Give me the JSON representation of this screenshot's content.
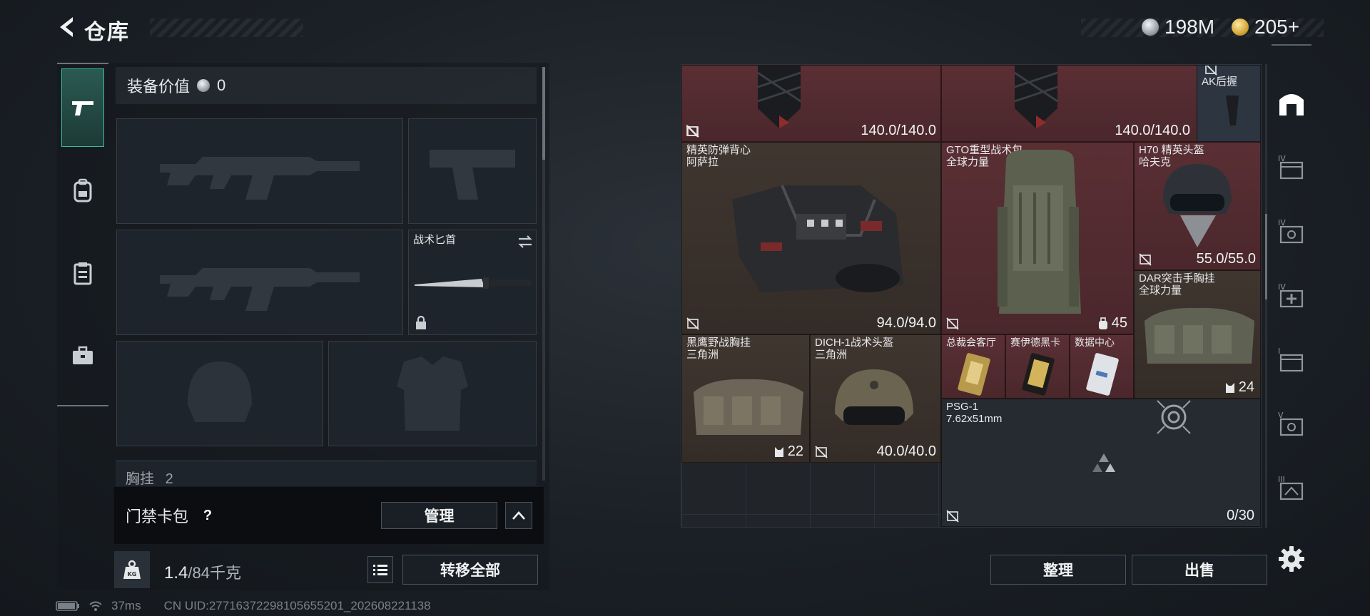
{
  "header": {
    "title": "仓库"
  },
  "currency": {
    "silver": {
      "value": "198M",
      "icon": "silver-coin-icon",
      "color": "#c8ccd0"
    },
    "gold": {
      "value": "205+",
      "icon": "gold-coin-icon",
      "color": "#d4a63a"
    }
  },
  "left": {
    "tabs": [
      "gun-icon",
      "backpack-icon",
      "clipboard-icon",
      "briefcase-icon"
    ],
    "equip_value_label": "装备价值",
    "equip_value": "0",
    "knife_slot": {
      "name": "战术匕首"
    },
    "chest_rig_label": "胸挂",
    "chest_rig_count": "2",
    "keycard": {
      "label": "门禁卡包",
      "help": "?",
      "manage": "管理"
    },
    "weight": {
      "current": "1.4",
      "max": "/84千克",
      "unit_icon": "KG"
    },
    "transfer_all": "转移全部"
  },
  "status": {
    "ping": "37ms",
    "uid": "CN UID:27716372298105655201_202608221138"
  },
  "grid": {
    "items": [
      {
        "id": "top-left",
        "durability": "140.0/140.0"
      },
      {
        "id": "top-mid",
        "durability": "140.0/140.0"
      },
      {
        "id": "ak-grip",
        "name": "AK后握"
      },
      {
        "id": "vest",
        "name1": "精英防弹背心",
        "name2": "阿萨拉",
        "durability": "94.0/94.0"
      },
      {
        "id": "backpack",
        "name1": "GTO重型战术包",
        "name2": "全球力量",
        "count": "45"
      },
      {
        "id": "h70",
        "name1": "H70 精英头盔",
        "name2": "哈夫克",
        "durability": "55.0/55.0"
      },
      {
        "id": "dar-rig",
        "name1": "DAR突击手胸挂",
        "name2": "全球力量",
        "count": "24"
      },
      {
        "id": "blackhawk-rig",
        "name1": "黑鹰野战胸挂",
        "name2": "三角洲",
        "count": "22"
      },
      {
        "id": "dich1",
        "name1": "DICH-1战术头盔",
        "name2": "三角洲",
        "durability": "40.0/40.0"
      },
      {
        "id": "card1",
        "name": "总裁会客厅"
      },
      {
        "id": "card2",
        "name": "赛伊德黑卡"
      },
      {
        "id": "card3",
        "name": "数据中心"
      },
      {
        "id": "psg1",
        "name1": "PSG-1",
        "name2": "7.62x51mm",
        "count": "0/30"
      }
    ]
  },
  "buttons": {
    "sort": "整理",
    "sell": "出售"
  },
  "rail": [
    "storage-home-icon",
    "tier-iv-case-icon",
    "tier-iv-ammo-icon",
    "tier-iv-med-icon",
    "tier-i-case-icon",
    "tier-v-ammo-icon",
    "tier-iii-case-icon",
    "settings-icon"
  ]
}
